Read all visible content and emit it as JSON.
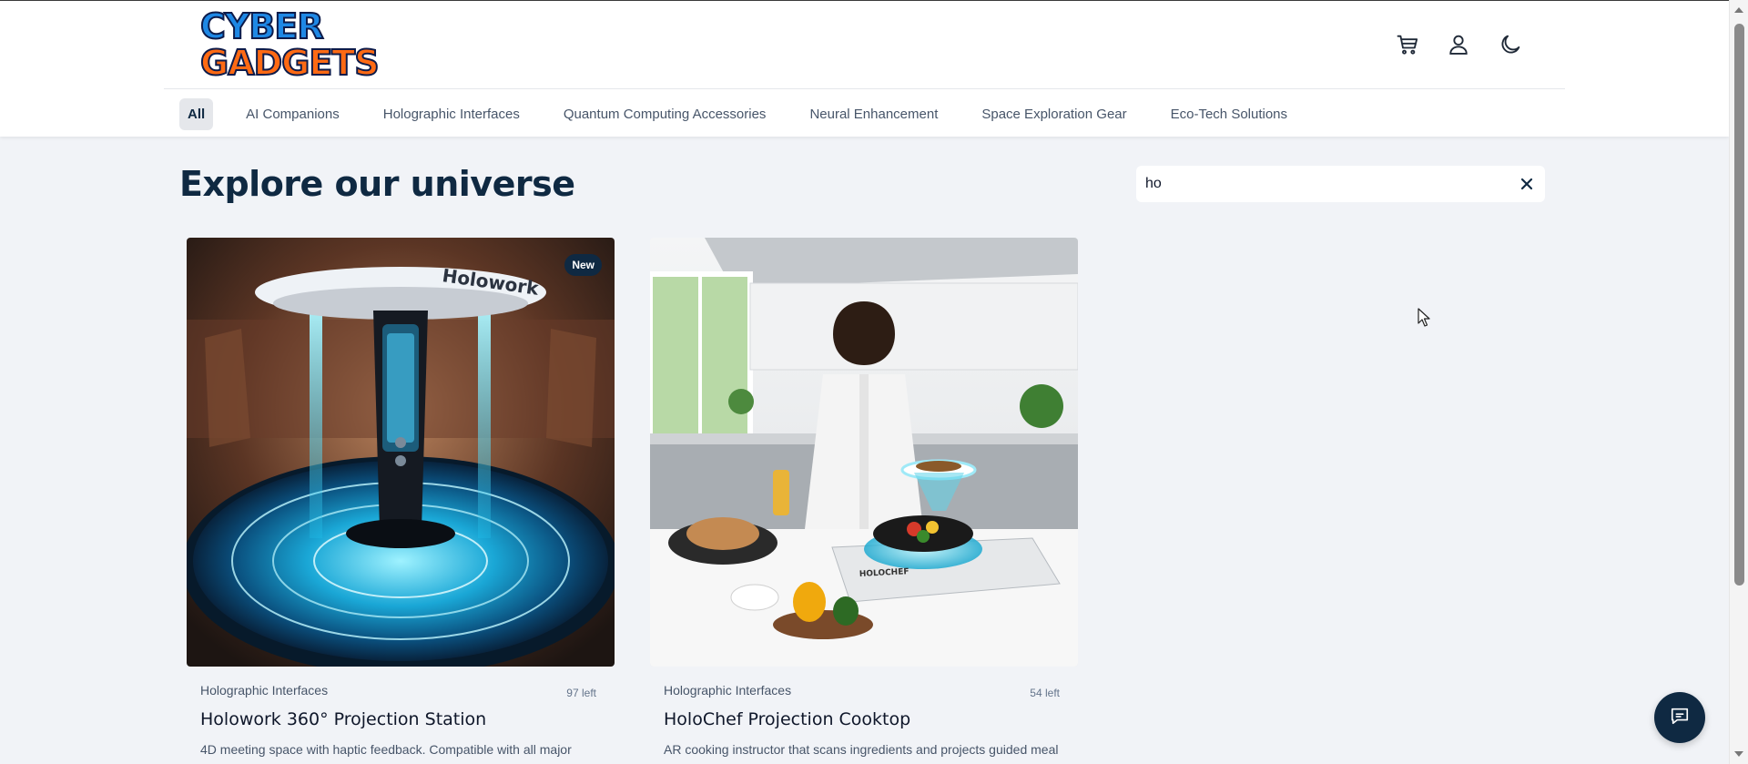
{
  "header": {
    "logo": {
      "line1": "CYBER",
      "line2": "GADGETS"
    },
    "icons": [
      "cart-icon",
      "user-icon",
      "moon-icon"
    ]
  },
  "nav": {
    "items": [
      {
        "label": "All",
        "active": true
      },
      {
        "label": "AI Companions"
      },
      {
        "label": "Holographic Interfaces"
      },
      {
        "label": "Quantum Computing Accessories"
      },
      {
        "label": "Neural Enhancement"
      },
      {
        "label": "Space Exploration Gear"
      },
      {
        "label": "Eco-Tech Solutions"
      }
    ]
  },
  "main": {
    "title": "Explore our universe"
  },
  "search": {
    "value": "ho",
    "clear_icon": "close-icon"
  },
  "products": [
    {
      "badge": "New",
      "category": "Holographic Interfaces",
      "stock": "97 left",
      "name": "Holowork 360° Projection Station",
      "description": "4D meeting space with haptic feedback. Compatible with all major",
      "image_label": "Holowork"
    },
    {
      "category": "Holographic Interfaces",
      "stock": "54 left",
      "name": "HoloChef Projection Cooktop",
      "description": "AR cooking instructor that scans ingredients and projects guided meal",
      "image_label": "HOLOCHEF"
    }
  ],
  "colors": {
    "brand": "#0f2942",
    "accent_cyan": "#22d3ee",
    "logo_blue": "#1e88e5",
    "logo_orange": "#ff6a13"
  }
}
